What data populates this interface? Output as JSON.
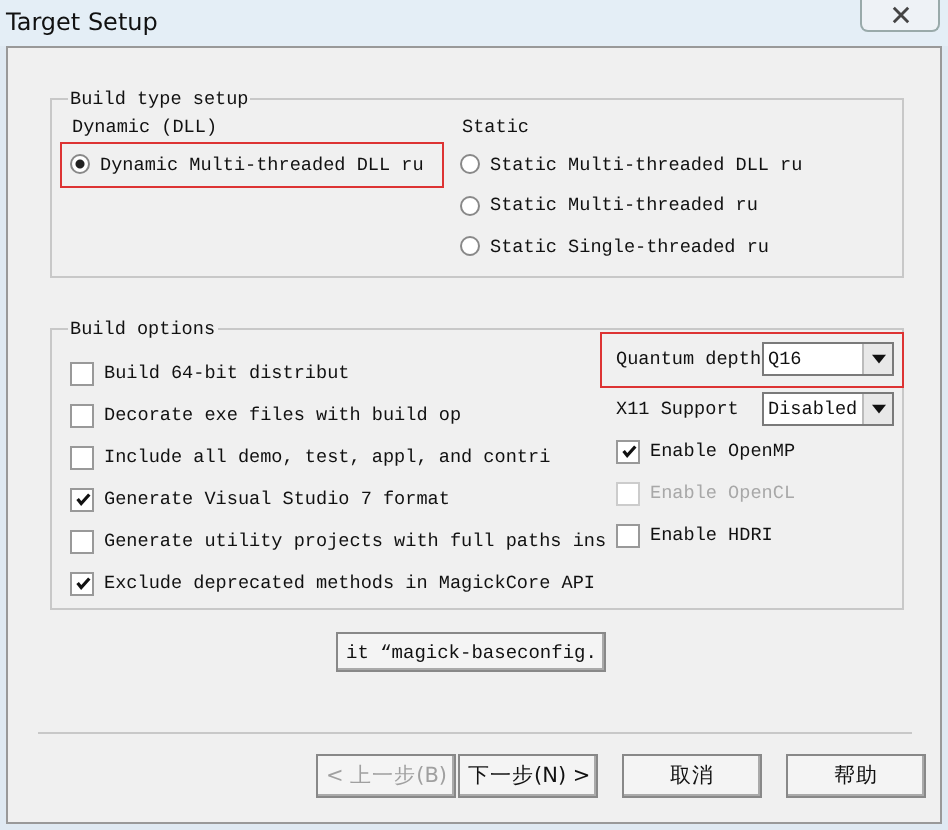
{
  "window": {
    "title": "Target Setup"
  },
  "build_type": {
    "title": "Build type setup",
    "dynamic": {
      "label": "Dynamic (DLL)",
      "options": [
        {
          "label": "Dynamic Multi-threaded DLL ru",
          "selected": true,
          "highlighted": true
        }
      ]
    },
    "static": {
      "label": "Static",
      "options": [
        {
          "label": "Static Multi-threaded DLL ru",
          "selected": false,
          "highlighted": false
        },
        {
          "label": "Static Multi-threaded ru",
          "selected": false,
          "highlighted": false
        },
        {
          "label": "Static Single-threaded ru",
          "selected": false,
          "highlighted": false
        }
      ]
    }
  },
  "build_options": {
    "title": "Build options",
    "options": [
      {
        "label": "Build 64-bit distribut",
        "checked": false
      },
      {
        "label": "Decorate exe files with build op",
        "checked": false
      },
      {
        "label": "Include all demo, test, appl, and contri",
        "checked": false
      },
      {
        "label": "Generate Visual Studio 7 format",
        "checked": true
      },
      {
        "label": "Generate utility projects with full paths ins",
        "checked": false
      },
      {
        "label": "Exclude deprecated methods in MagickCore API",
        "checked": true
      }
    ],
    "settings": [
      {
        "kind": "dropdown",
        "label": "Quantum depth",
        "value": "Q16",
        "highlighted": true
      },
      {
        "kind": "dropdown",
        "label": "X11 Support",
        "value": "Disabled",
        "highlighted": false
      },
      {
        "kind": "checkbox",
        "label": "Enable OpenMP",
        "checked": true,
        "disabled": false
      },
      {
        "kind": "checkbox",
        "label": "Enable OpenCL",
        "checked": false,
        "disabled": true
      },
      {
        "kind": "checkbox",
        "label": "Enable HDRI",
        "checked": false,
        "disabled": false
      }
    ]
  },
  "edit_button": {
    "label": "it “magick-baseconfig."
  },
  "footer_buttons": [
    {
      "label": "< 上一步(B)",
      "disabled": true
    },
    {
      "label": "下一步(N) >",
      "disabled": false
    },
    {
      "label": "取消",
      "disabled": false
    },
    {
      "label": "帮助",
      "disabled": false
    }
  ]
}
